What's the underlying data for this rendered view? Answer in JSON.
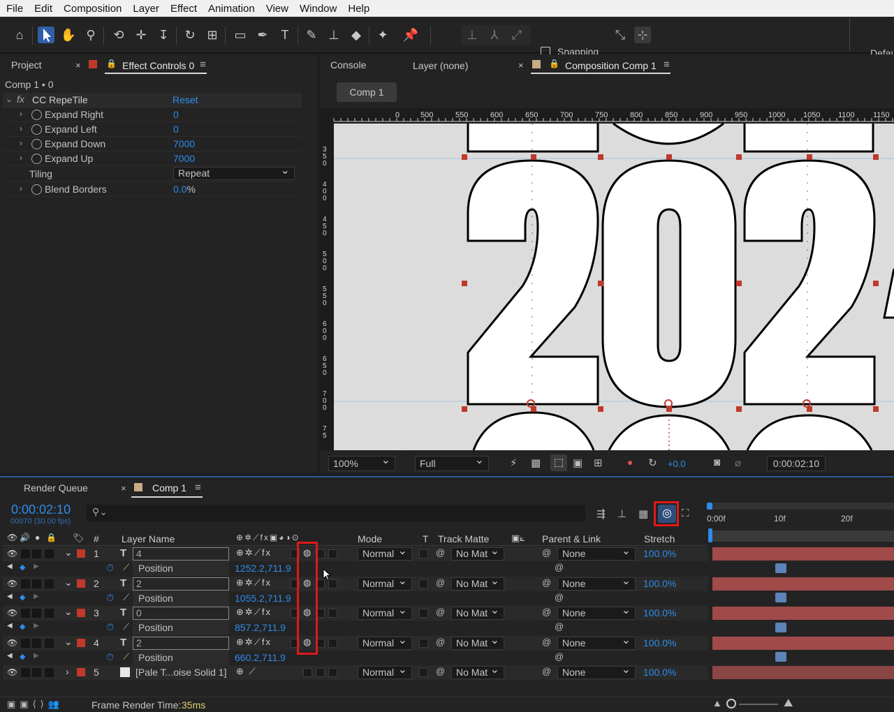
{
  "menu": [
    "File",
    "Edit",
    "Composition",
    "Layer",
    "Effect",
    "Animation",
    "View",
    "Window",
    "Help"
  ],
  "toolbar": {
    "snapping_label": "Snapping",
    "workspace_label": "Defau"
  },
  "project_panel": {
    "tab_project": "Project",
    "tab_effect_controls": "Effect Controls 0",
    "breadcrumb": "Comp 1 • 0",
    "effect_name": "CC RepeTile",
    "reset_label": "Reset",
    "params": [
      {
        "label": "Expand Right",
        "value": "0"
      },
      {
        "label": "Expand Left",
        "value": "0"
      },
      {
        "label": "Expand Down",
        "value": "7000"
      },
      {
        "label": "Expand Up",
        "value": "7000"
      }
    ],
    "tiling_label": "Tiling",
    "tiling_value": "Repeat",
    "blend_label": "Blend Borders",
    "blend_value": "0.0",
    "blend_unit": "%"
  },
  "viewer_panel": {
    "tab_console": "Console",
    "tab_layer": "Layer (none)",
    "tab_comp": "Composition Comp 1",
    "comp_pill": "Comp 1",
    "ruler_top": [
      "0",
      "500",
      "550",
      "600",
      "650",
      "700",
      "750",
      "800",
      "850",
      "900",
      "950",
      "1000",
      "1050",
      "1100",
      "1150"
    ],
    "ruler_left": [
      "3\n5\n0",
      "4\n0\n0",
      "4\n5\n0",
      "5\n0\n0",
      "5\n5\n0",
      "6\n0\n0",
      "6\n5\n0",
      "7\n0\n0",
      "7\n5"
    ],
    "zoom": "100%",
    "resolution": "Full",
    "exposure": "+0.0",
    "timecode": "0:00:02:10"
  },
  "timeline": {
    "tab_render_queue": "Render Queue",
    "tab_comp": "Comp 1",
    "timecode": "0:00:02:10",
    "frame_info": "00070 (30.00 fps)",
    "search_placeholder": "",
    "ruler": [
      "0:00f",
      "10f",
      "20f"
    ],
    "columns": {
      "num": "#",
      "layer_name": "Layer Name",
      "mode": "Mode",
      "t": "T",
      "track_matte": "Track Matte",
      "parent": "Parent & Link",
      "stretch": "Stretch"
    },
    "layers": [
      {
        "num": "1",
        "name": "4",
        "mode": "Normal",
        "matte": "No Mat",
        "parent": "None",
        "stretch": "100.0%",
        "position_label": "Position",
        "position": "1252.2,711.9"
      },
      {
        "num": "2",
        "name": "2",
        "mode": "Normal",
        "matte": "No Mat",
        "parent": "None",
        "stretch": "100.0%",
        "position_label": "Position",
        "position": "1055.2,711.9"
      },
      {
        "num": "3",
        "name": "0",
        "mode": "Normal",
        "matte": "No Mat",
        "parent": "None",
        "stretch": "100.0%",
        "position_label": "Position",
        "position": "857.2,711.9"
      },
      {
        "num": "4",
        "name": "2",
        "mode": "Normal",
        "matte": "No Mat",
        "parent": "None",
        "stretch": "100.0%",
        "position_label": "Position",
        "position": "660.2,711.9"
      }
    ],
    "layer5": {
      "num": "5",
      "name": "[Pale T...oise Solid 1]",
      "mode": "Normal",
      "matte": "No Mat",
      "parent": "None",
      "stretch": "100.0%"
    },
    "footer_label": "Frame Render Time:",
    "footer_value": "35ms"
  },
  "colors": {
    "accent_blue": "#2d8ceb",
    "label_red": "#c0392b",
    "highlight_red": "#e01818",
    "track_red": "#a14a4a"
  }
}
